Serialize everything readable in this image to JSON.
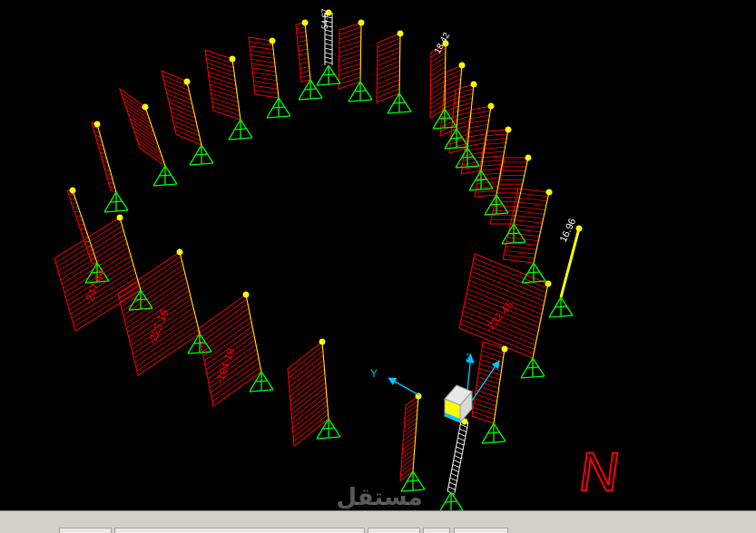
{
  "colors": {
    "background": "#000000",
    "moment_diagram": "#ff0000",
    "support": "#00ff00",
    "joint": "#ffff00",
    "column": "#ffff00",
    "ladder": "#ffffff",
    "axis": "#00c8ff",
    "north_marker": "#ff0000",
    "status_bar": "#d4d0c8"
  },
  "labels": {
    "top_column_value": "54.67",
    "right_top_value": "18.42",
    "right_column_value": "16.96",
    "moment_left_1": "-247.44",
    "moment_left_2": "-225.16",
    "moment_left_3": "-194.18",
    "moment_right_1": "-232.45"
  },
  "axes": {
    "y": "Y",
    "z": "Z"
  },
  "north": "N",
  "watermark": "مستقل",
  "icons": {
    "cube": "local-axis-cube-icon",
    "support": "fixed-support-icon"
  }
}
